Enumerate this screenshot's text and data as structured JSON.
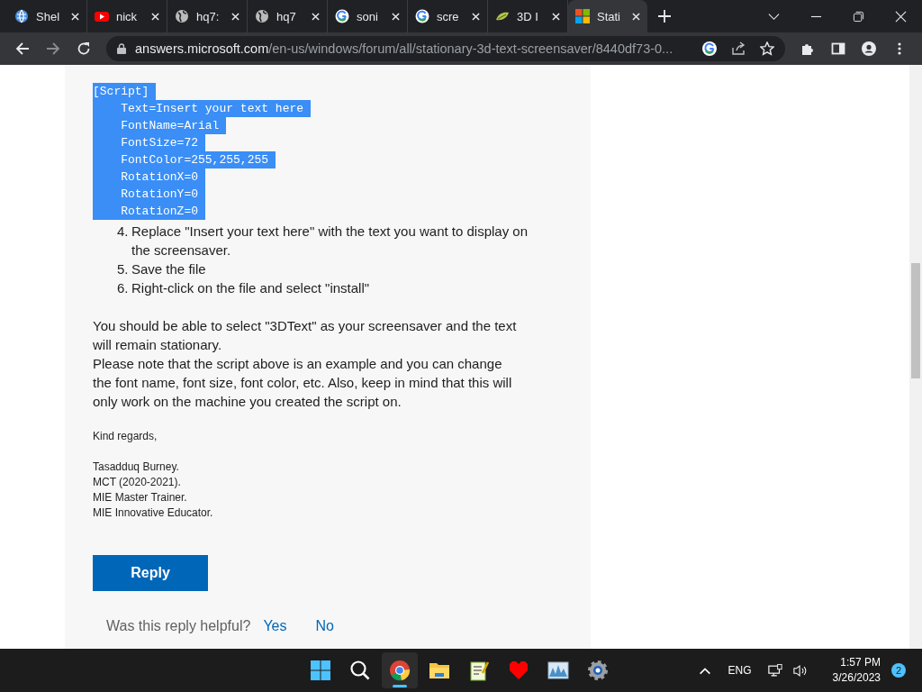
{
  "browser": {
    "tabs": [
      {
        "title": "Shel",
        "kind": "globeblue",
        "selected": false
      },
      {
        "title": "nick",
        "kind": "video",
        "selected": false
      },
      {
        "title": "hq7:",
        "kind": "globe",
        "selected": false
      },
      {
        "title": "hq7",
        "kind": "globe",
        "selected": false
      },
      {
        "title": "soni",
        "kind": "google",
        "selected": false
      },
      {
        "title": "scre",
        "kind": "google",
        "selected": false
      },
      {
        "title": "3D I",
        "kind": "leaf",
        "selected": false
      },
      {
        "title": "Stati",
        "kind": "squares",
        "selected": true
      }
    ],
    "address": {
      "host": "answers.microsoft.com",
      "path": "/en-us/windows/forum/all/stationary-3d-text-screensaver/8440df73-0..."
    }
  },
  "post": {
    "code_lines": [
      {
        "text": "[Script]"
      },
      {
        "text": "    Text=Insert your text here"
      },
      {
        "text": "    FontName=Arial"
      },
      {
        "text": "    FontSize=72"
      },
      {
        "text": "    FontColor=255,255,255"
      },
      {
        "text": "    RotationX=0"
      },
      {
        "text": "    RotationY=0"
      },
      {
        "text": "    RotationZ=0"
      }
    ],
    "steps": [
      {
        "number": "4.",
        "text": "Replace \"Insert your text here\" with the text you want to display on the screensaver."
      },
      {
        "number": "5.",
        "text": "Save the file"
      },
      {
        "number": "6.",
        "text": "Right-click on the file and select \"install\""
      }
    ],
    "paragraphs": [
      "You should be able to select \"3DText\" as your screensaver and the text will remain stationary.",
      "Please note that the script above is an example and you can change the font name, font size, font color, etc. Also, keep in mind that this will only work on the machine you created the script on."
    ],
    "closing": "Kind regards,",
    "signature": [
      "Tasadduq Burney.",
      "MCT (2020-2021).",
      "MIE Master Trainer.",
      "MIE Innovative Educator."
    ],
    "reply_button": "Reply",
    "helpful": {
      "question": "Was this reply helpful?",
      "yes": "Yes",
      "no": "No"
    }
  },
  "taskbar": {
    "apps": [
      {
        "kind": "start",
        "active": false
      },
      {
        "kind": "search",
        "active": false
      },
      {
        "kind": "chrome",
        "active": true
      },
      {
        "kind": "folder",
        "active": false
      },
      {
        "kind": "notepad",
        "active": false
      },
      {
        "kind": "heart",
        "active": false
      },
      {
        "kind": "monitor",
        "active": false
      },
      {
        "kind": "gear",
        "active": false
      }
    ],
    "language": "ENG",
    "time": "1:57 PM",
    "date": "3/26/2023",
    "notifications": "2"
  }
}
